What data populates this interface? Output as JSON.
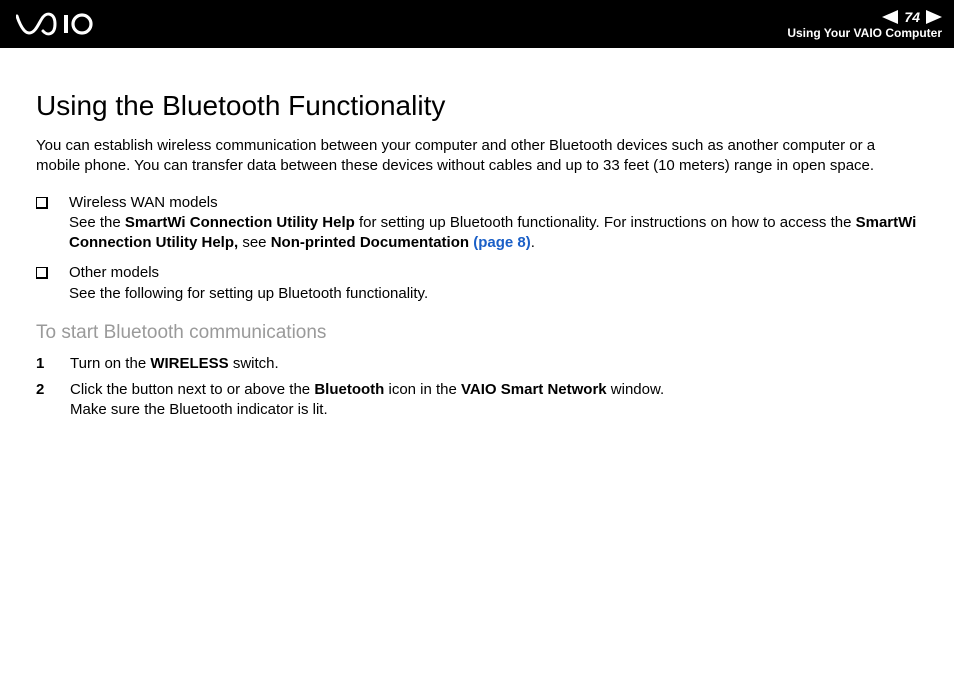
{
  "header": {
    "page_number": "74",
    "section": "Using Your VAIO Computer"
  },
  "main": {
    "title": "Using the Bluetooth Functionality",
    "intro": "You can establish wireless communication between your computer and other Bluetooth devices such as another computer or a mobile phone. You can transfer data between these devices without cables and up to 33 feet (10 meters) range in open space.",
    "bullets": [
      {
        "head": "Wireless WAN models",
        "pre": "See the ",
        "bold1": "SmartWi Connection Utility Help",
        "mid": " for setting up Bluetooth functionality. For instructions on how to access the ",
        "bold2": "SmartWi Connection Utility Help,",
        "mid2": " see ",
        "bold3": "Non-printed Documentation ",
        "link": "(page 8)",
        "tail": "."
      },
      {
        "head": "Other models",
        "body": "See the following for setting up Bluetooth functionality."
      }
    ],
    "subheading": "To start Bluetooth communications",
    "steps": [
      {
        "num": "1",
        "pre": "Turn on the ",
        "bold1": "WIRELESS",
        "post": " switch."
      },
      {
        "num": "2",
        "pre": "Click the button next to or above the ",
        "bold1": "Bluetooth",
        "mid": " icon in the ",
        "bold2": "VAIO Smart Network",
        "post": " window.",
        "line2": "Make sure the Bluetooth indicator is lit."
      }
    ]
  }
}
